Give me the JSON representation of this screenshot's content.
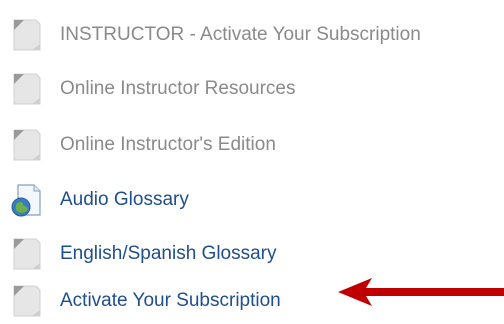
{
  "items": [
    {
      "label": "INSTRUCTOR - Activate Your Subscription",
      "icon": "page-icon",
      "style": "gray"
    },
    {
      "label": "Online Instructor Resources",
      "icon": "page-icon",
      "style": "gray"
    },
    {
      "label": "Online Instructor's Edition",
      "icon": "page-icon",
      "style": "gray"
    },
    {
      "label": "Audio Glossary",
      "icon": "audio-file-icon",
      "style": "blue"
    },
    {
      "label": "English/Spanish Glossary",
      "icon": "page-icon",
      "style": "blue"
    },
    {
      "label": "Activate Your Subscription",
      "icon": "page-icon",
      "style": "blue"
    }
  ],
  "colors": {
    "link": "#1f4e8c",
    "disabled": "#8a8a8a",
    "arrow": "#c00000"
  }
}
